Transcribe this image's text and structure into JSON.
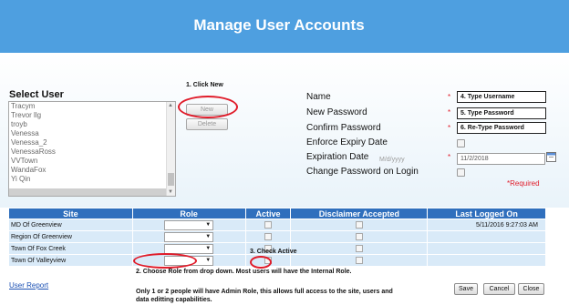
{
  "header": {
    "title": "Manage User Accounts"
  },
  "colors": {
    "header_bg": "#4e9fe0",
    "grid_header_bg": "#2f6fbd",
    "grid_row_bg": "#d9eaf8",
    "annotation_red": "#e01c2a"
  },
  "select_user": {
    "label": "Select User",
    "users": [
      "Tracym",
      "Trevor llg",
      "troyb",
      "Venessa",
      "Venessa_2",
      "VenessaRoss",
      "VVTown",
      "WandaFox",
      "Yi Qin"
    ]
  },
  "buttons": {
    "new_label": "New",
    "delete_label": "Delete",
    "save_label": "Save",
    "cancel_label": "Cancel",
    "close_label": "Close"
  },
  "annotations": {
    "click_new": "1. Click New",
    "choose_role": "2. Choose Role from drop down.  Most users will have the Internal Role.",
    "check_active": "3. Check Active",
    "admin_note_line1": "Only 1 or 2 people will have Admin Role, this allows full access to the site, users and",
    "admin_note_line2": "data editting capabilities."
  },
  "form": {
    "name_label": "Name",
    "name_value": "4. Type Username",
    "new_password_label": "New Password",
    "new_password_value": "5. Type Password",
    "confirm_password_label": "Confirm Password",
    "confirm_password_value": "6. Re-Type Password",
    "enforce_expiry_label": "Enforce Expiry Date",
    "expiration_label": "Expiration Date",
    "expiration_hint": "M/d/yyyy",
    "expiration_value": "11/2/2018",
    "change_password_label": "Change Password on Login",
    "required_mark": "*",
    "required_text": "*Required",
    "calendar_icon": "calendar-icon"
  },
  "grid": {
    "headers": {
      "site": "Site",
      "role": "Role",
      "active": "Active",
      "disclaimer": "Disclaimer Accepted",
      "last_logged": "Last Logged On"
    },
    "rows": [
      {
        "site": "MD Of Greenview",
        "last_logged": "5/11/2016 9:27:03 AM"
      },
      {
        "site": "Region Of Greenview",
        "last_logged": ""
      },
      {
        "site": "Town Of Fox Creek",
        "last_logged": ""
      },
      {
        "site": "Town Of Valleyview",
        "last_logged": ""
      }
    ]
  },
  "footer": {
    "user_report_label": "User Report"
  }
}
